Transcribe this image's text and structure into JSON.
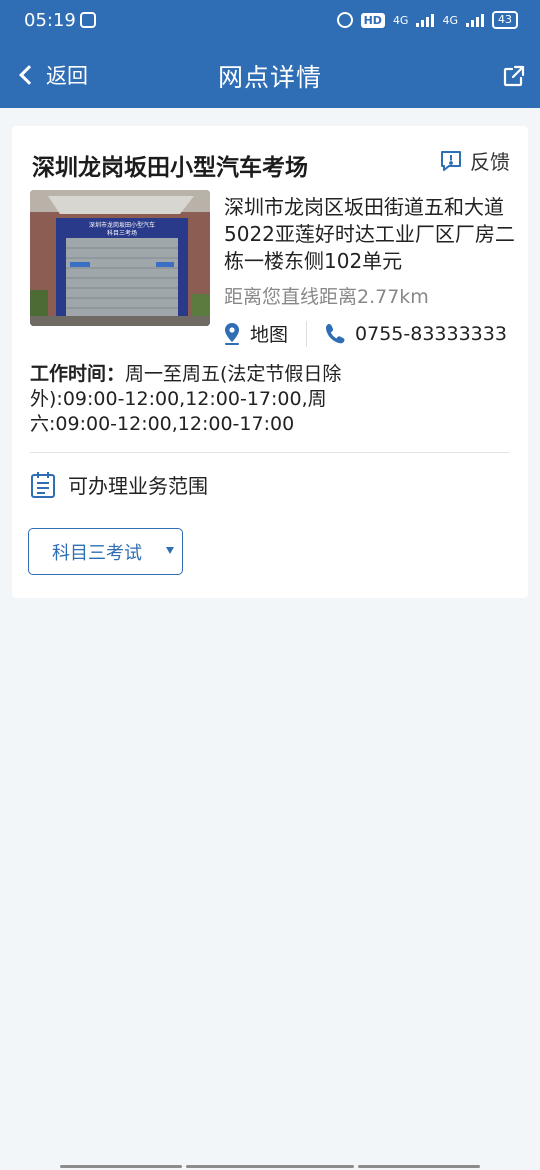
{
  "status_bar": {
    "time": "05:19",
    "hd_badge": "HD",
    "network_1": "4G",
    "network_2": "4G",
    "battery": "43"
  },
  "header": {
    "back_label": "返回",
    "title": "网点详情",
    "icons": {
      "back": "chevron-left-icon",
      "share": "share-external-icon"
    },
    "background_color": "#2f6db5"
  },
  "site": {
    "name": "深圳龙岗坂田小型汽车考场",
    "feedback_label": "反馈",
    "address": "深圳市龙岗区坂田街道五和大道5022亚莲好时达工业厂区厂房二栋一楼东侧102单元",
    "distance": "距离您直线距离2.77km",
    "map_label": "地图",
    "phone": "0755-83333333",
    "hours_label": "工作时间：",
    "hours_value": "周一至周五(法定节假日除外):09:00-12:00,12:00-17:00,周六:09:00-12:00,12:00-17:00",
    "photo_sign_line1": "深圳市龙岗坂田小型汽车",
    "photo_sign_line2": "科目三考场"
  },
  "business_scope": {
    "label": "可办理业务范围",
    "selected": "科目三考试"
  },
  "colors": {
    "accent": "#2f6db5",
    "page_bg": "#f3f6f9",
    "card_bg": "#ffffff",
    "muted_text": "#888888"
  }
}
